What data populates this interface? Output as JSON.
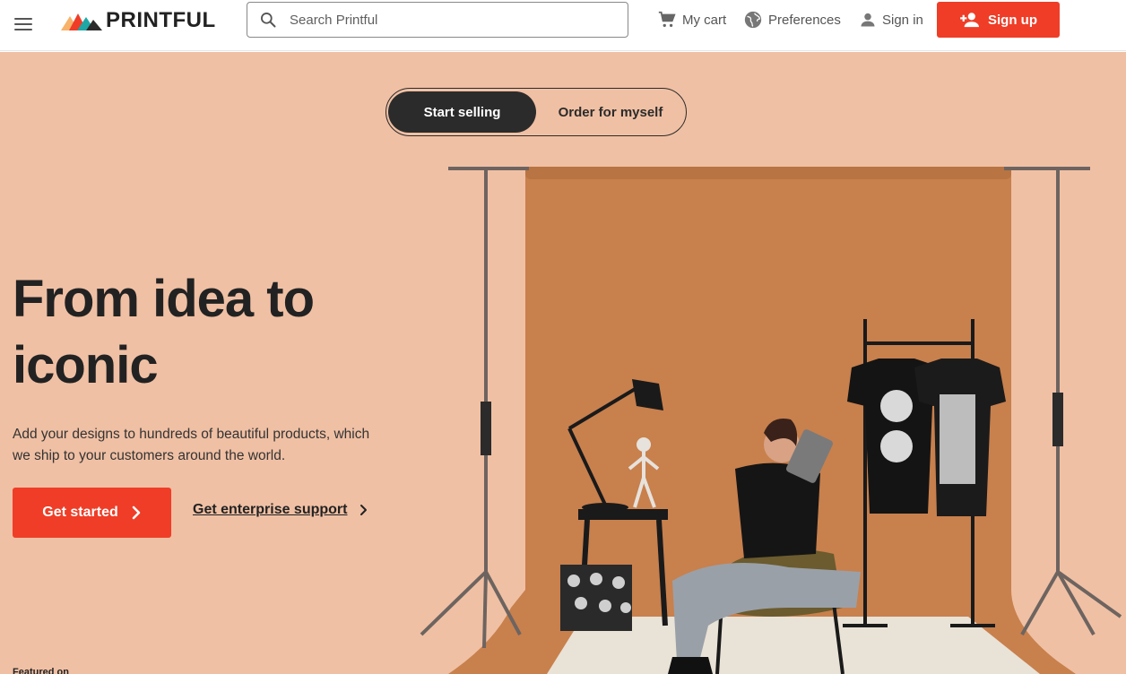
{
  "header": {
    "logo_text": "PRINTFUL",
    "search": {
      "placeholder": "Search Printful",
      "value": ""
    },
    "cart_label": "My cart",
    "preferences_label": "Preferences",
    "signin_label": "Sign in",
    "signup_label": "Sign up"
  },
  "hero": {
    "toggle": {
      "active": "Start selling",
      "inactive": "Order for myself"
    },
    "headline_line1": "From idea to",
    "headline_line2": "iconic",
    "subtext_line1": "Add your designs to hundreds of beautiful products, which",
    "subtext_line2": "we ship to your customers around the world.",
    "cta_label": "Get started",
    "enterprise_label": "Get enterprise support",
    "featured_label": "Featured on"
  },
  "colors": {
    "accent": "#ef3d27",
    "hero_bg": "#f0c0a4",
    "backdrop": "#c9814f",
    "dark": "#2b2b2b"
  },
  "icons": [
    "hamburger-icon",
    "search-icon",
    "cart-icon",
    "globe-icon",
    "user-icon",
    "add-user-icon",
    "chevron-right-icon"
  ]
}
